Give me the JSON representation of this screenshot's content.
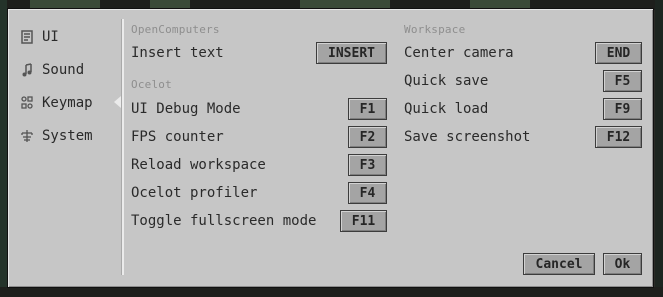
{
  "sidebar": {
    "items": [
      {
        "label": "UI",
        "icon": "ui-icon"
      },
      {
        "label": "Sound",
        "icon": "music-note-icon"
      },
      {
        "label": "Keymap",
        "icon": "keymap-icon",
        "selected": true
      },
      {
        "label": "System",
        "icon": "system-tree-icon"
      }
    ]
  },
  "left_column": {
    "opencomputers": {
      "title": "OpenComputers",
      "rows": [
        {
          "label": "Insert text",
          "key": "INSERT"
        }
      ]
    },
    "ocelot": {
      "title": "Ocelot",
      "rows": [
        {
          "label": "UI Debug Mode",
          "key": "F1"
        },
        {
          "label": "FPS counter",
          "key": "F2"
        },
        {
          "label": "Reload workspace",
          "key": "F3"
        },
        {
          "label": "Ocelot profiler",
          "key": "F4"
        },
        {
          "label": "Toggle fullscreen mode",
          "key": "F11"
        }
      ]
    }
  },
  "right_column": {
    "workspace": {
      "title": "Workspace",
      "rows": [
        {
          "label": "Center camera",
          "key": "END"
        },
        {
          "label": "Quick save",
          "key": "F5"
        },
        {
          "label": "Quick load",
          "key": "F9"
        },
        {
          "label": "Save screenshot",
          "key": "F12"
        }
      ]
    }
  },
  "buttons": {
    "cancel": "Cancel",
    "ok": "Ok"
  },
  "colors": {
    "dialog_bg": "#c6c6c6",
    "button_bg": "#a4a4a4",
    "section_title": "#8e8e8e",
    "text": "#2a2a2a"
  }
}
